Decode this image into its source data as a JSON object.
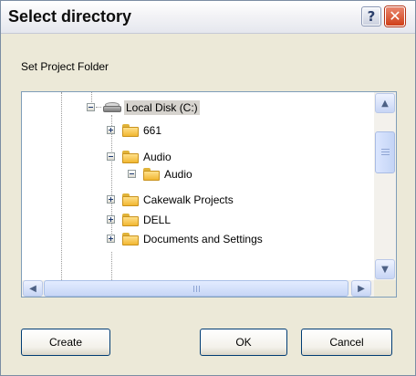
{
  "window": {
    "title": "Select directory",
    "help_glyph": "?",
    "close_glyph": "✕"
  },
  "prompt": "Set Project Folder",
  "tree": {
    "root": {
      "label": "Local Disk (C:)",
      "selected": true,
      "expanded": true
    },
    "items": [
      {
        "label": "661",
        "expanded": false,
        "level": 1
      },
      {
        "label": "Audio",
        "expanded": true,
        "level": 1
      },
      {
        "label": "Audio",
        "expanded": true,
        "level": 2
      },
      {
        "label": "Cakewalk Projects",
        "expanded": false,
        "level": 1
      },
      {
        "label": "DELL",
        "expanded": false,
        "level": 1
      },
      {
        "label": "Documents and Settings",
        "expanded": false,
        "level": 1
      }
    ]
  },
  "scrollbars": {
    "up_arrow": "▲",
    "down_arrow": "▼",
    "left_arrow": "◀",
    "right_arrow": "▶"
  },
  "buttons": {
    "create": "Create",
    "ok": "OK",
    "cancel": "Cancel"
  },
  "icons": {
    "disk": "hard-drive-icon",
    "folder": "folder-icon"
  }
}
